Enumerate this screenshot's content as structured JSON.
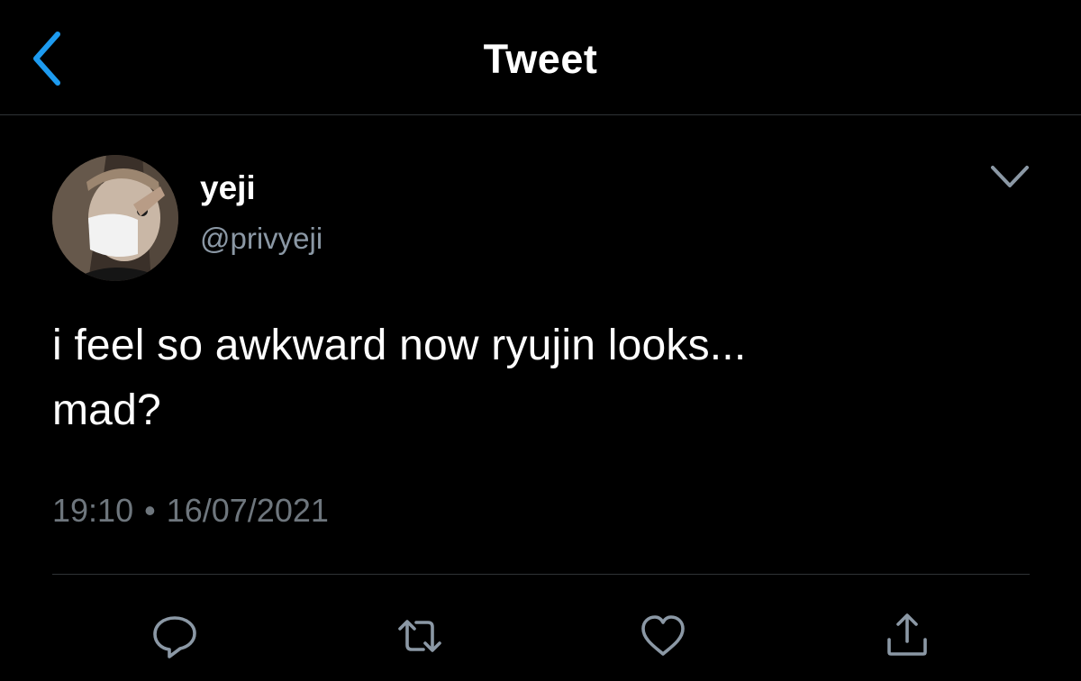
{
  "header": {
    "title": "Tweet",
    "back_icon": "chevron-left-icon"
  },
  "tweet": {
    "author": {
      "display_name": "yeji",
      "handle": "@privyeji"
    },
    "text_lines": [
      "i feel so awkward now ryujin looks...",
      "mad?"
    ],
    "time": "19:10",
    "separator": "•",
    "date": "16/07/2021"
  },
  "actions": [
    {
      "name": "reply",
      "icon": "reply-icon"
    },
    {
      "name": "retweet",
      "icon": "retweet-icon"
    },
    {
      "name": "like",
      "icon": "heart-icon"
    },
    {
      "name": "share",
      "icon": "share-icon"
    }
  ],
  "colors": {
    "background": "#000000",
    "accent": "#1d9bf0",
    "secondary_text": "#6e767d",
    "divider": "#2f3336"
  }
}
